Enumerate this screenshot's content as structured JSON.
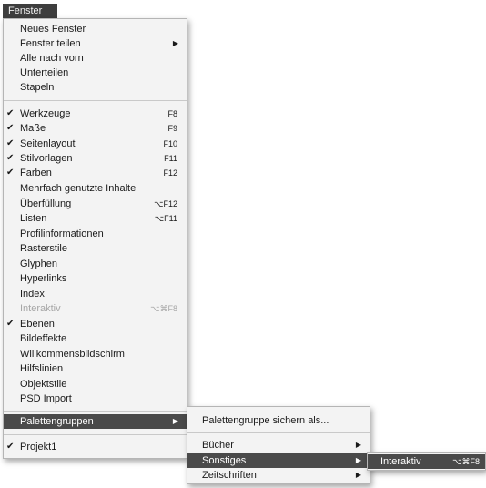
{
  "menubar": {
    "title": "Fenster"
  },
  "menu": {
    "items": [
      {
        "label": "Neues Fenster"
      },
      {
        "label": "Fenster teilen"
      },
      {
        "label": "Alle nach vorn"
      },
      {
        "label": "Unterteilen"
      },
      {
        "label": "Stapeln"
      },
      {
        "label": "Werkzeuge",
        "shortcut": "F8"
      },
      {
        "label": "Maße",
        "shortcut": "F9"
      },
      {
        "label": "Seitenlayout",
        "shortcut": "F10"
      },
      {
        "label": "Stilvorlagen",
        "shortcut": "F11"
      },
      {
        "label": "Farben",
        "shortcut": "F12"
      },
      {
        "label": "Mehrfach genutzte Inhalte"
      },
      {
        "label": "Überfüllung",
        "shortcut": "⌥F12"
      },
      {
        "label": "Listen",
        "shortcut": "⌥F11"
      },
      {
        "label": "Profilinformationen"
      },
      {
        "label": "Rasterstile"
      },
      {
        "label": "Glyphen"
      },
      {
        "label": "Hyperlinks"
      },
      {
        "label": "Index"
      },
      {
        "label": "Interaktiv",
        "shortcut": "⌥⌘F8"
      },
      {
        "label": "Ebenen"
      },
      {
        "label": "Bildeffekte"
      },
      {
        "label": "Willkommensbildschirm"
      },
      {
        "label": "Hilfslinien"
      },
      {
        "label": "Objektstile"
      },
      {
        "label": "PSD Import"
      },
      {
        "label": "Palettengruppen"
      },
      {
        "label": "Projekt1"
      }
    ],
    "check_mark": "✔"
  },
  "submenu": {
    "items": [
      {
        "label": "Palettengruppe sichern als..."
      },
      {
        "label": "Bücher"
      },
      {
        "label": "Sonstiges"
      },
      {
        "label": "Zeitschriften"
      }
    ]
  },
  "subsubmenu": {
    "items": [
      {
        "label": "Interaktiv",
        "shortcut": "⌥⌘F8"
      }
    ]
  }
}
